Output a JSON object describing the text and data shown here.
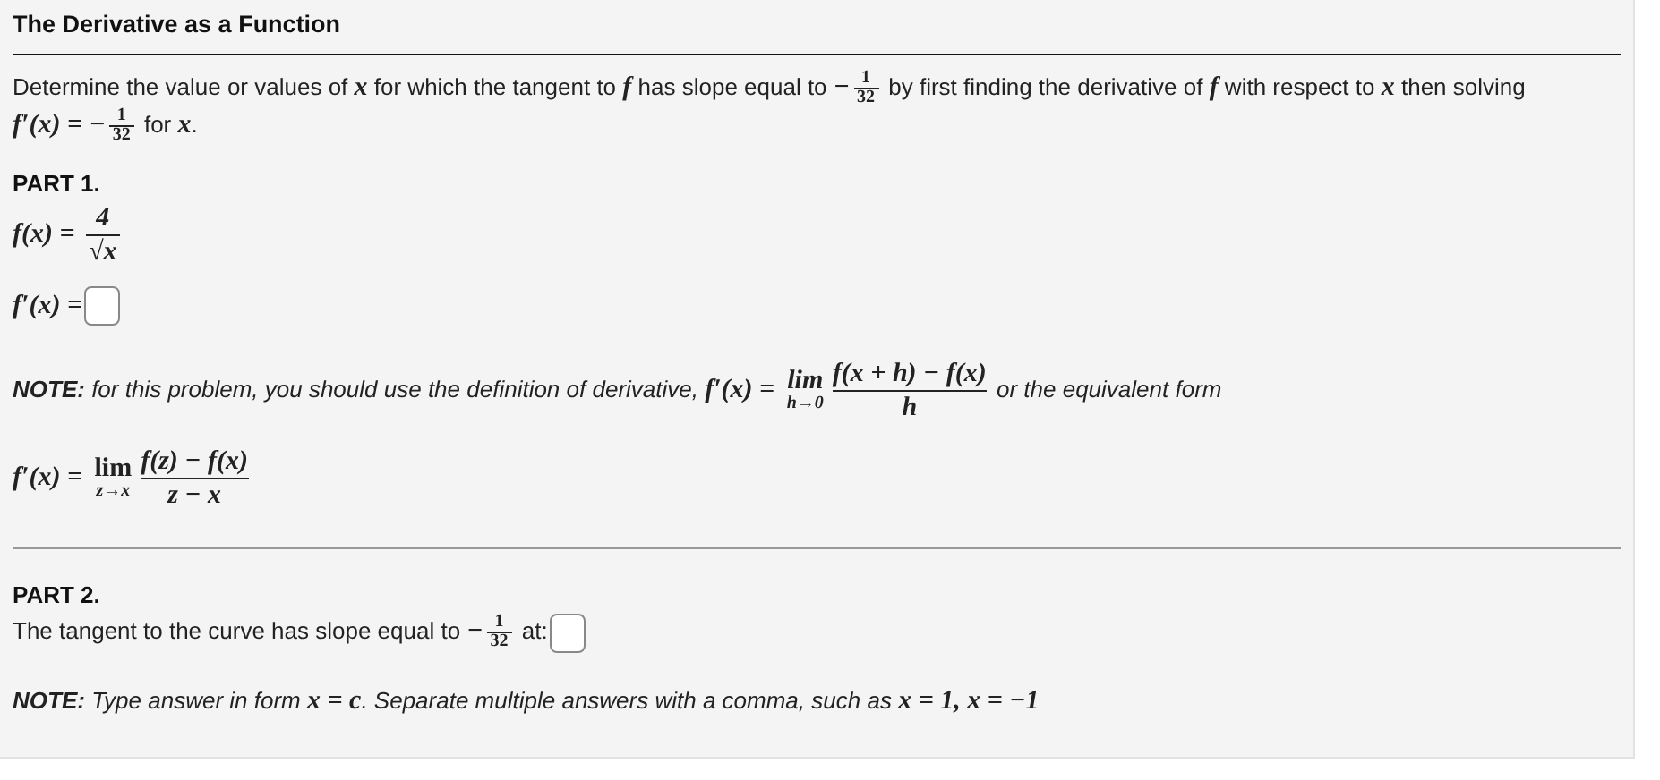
{
  "blocks": [
    {
      "kind": "title",
      "text": "The Derivative as a Function"
    },
    {
      "kind": "divider"
    },
    {
      "kind": "para",
      "segments": [
        {
          "kind": "text",
          "text": "Determine the value or values of "
        },
        {
          "kind": "math",
          "text": "x"
        },
        {
          "kind": "text",
          "text": " for which the tangent to "
        },
        {
          "kind": "math",
          "text": "f"
        },
        {
          "kind": "text",
          "text": " has slope equal to "
        },
        {
          "kind": "math",
          "text": "−"
        },
        {
          "kind": "frac",
          "num": "1",
          "den": "32"
        },
        {
          "kind": "text",
          "text": " by first finding the derivative of "
        },
        {
          "kind": "math",
          "text": "f"
        },
        {
          "kind": "text",
          "text": " with respect to "
        },
        {
          "kind": "math",
          "text": "x"
        },
        {
          "kind": "text",
          "text": " then solving "
        },
        {
          "kind": "math",
          "text": "f′(x) = −"
        },
        {
          "kind": "frac",
          "num": "1",
          "den": "32"
        },
        {
          "kind": "text",
          "text": " for "
        },
        {
          "kind": "math",
          "text": "x"
        },
        {
          "kind": "text",
          "text": "."
        }
      ]
    },
    {
      "kind": "part",
      "text": "PART 1."
    },
    {
      "kind": "formula",
      "segments": [
        {
          "kind": "math",
          "text": "f(x) = "
        },
        {
          "kind": "display_frac",
          "num": "4",
          "den": "√x"
        }
      ]
    },
    {
      "kind": "formula",
      "segments": [
        {
          "kind": "math",
          "text": "f′(x) ="
        },
        {
          "kind": "input"
        }
      ]
    },
    {
      "kind": "note",
      "segments": [
        {
          "kind": "text",
          "text": "**NOTE:** for this problem, you should use the definition of derivative, "
        },
        {
          "kind": "math",
          "text": "f′(x) = "
        },
        {
          "kind": "lim",
          "sub": "h→0"
        },
        {
          "kind": "display_frac",
          "num": "f(x + h) − f(x)",
          "den": "h"
        },
        {
          "kind": "text",
          "text": " or the equivalent form"
        }
      ]
    },
    {
      "kind": "formula",
      "segments": [
        {
          "kind": "math",
          "text": "f′(x) = "
        },
        {
          "kind": "lim",
          "sub": "z→x"
        },
        {
          "kind": "display_frac",
          "num": "f(z) − f(x)",
          "den": "z − x"
        }
      ]
    },
    {
      "kind": "divider"
    },
    {
      "kind": "part",
      "text": "PART 2."
    },
    {
      "kind": "para",
      "segments": [
        {
          "kind": "text",
          "text": "The tangent to the curve has slope equal to "
        },
        {
          "kind": "math",
          "text": "−"
        },
        {
          "kind": "frac",
          "num": "1",
          "den": "32"
        },
        {
          "kind": "text",
          "text": " at:"
        },
        {
          "kind": "input"
        }
      ]
    },
    {
      "kind": "note",
      "segments": [
        {
          "kind": "text",
          "text": "**NOTE:** Type answer in form "
        },
        {
          "kind": "math",
          "text": "x = c"
        },
        {
          "kind": "text",
          "text": ". Separate multiple answers with a comma, such as "
        },
        {
          "kind": "math",
          "text": "x = 1, x = −1"
        }
      ]
    }
  ]
}
